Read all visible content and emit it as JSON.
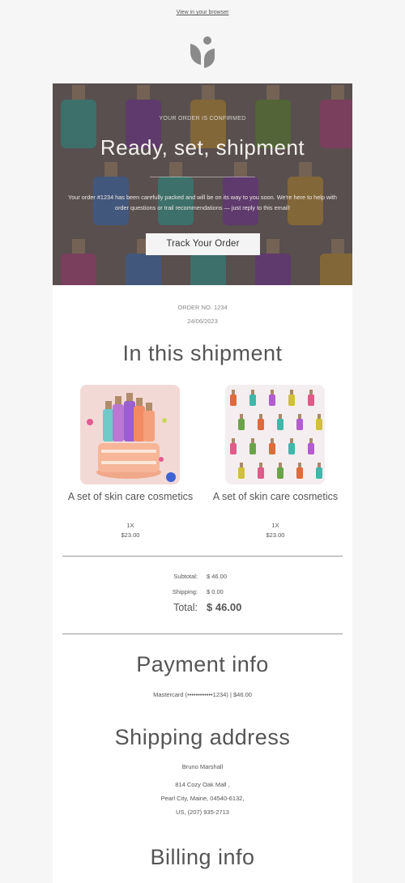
{
  "header": {
    "view_in_browser": "View in your browser",
    "logo_icon": "leaf-logo-icon"
  },
  "hero": {
    "eyebrow": "YOUR ORDER IS CONFIRMED",
    "title": "Ready, set, shipment",
    "body": "Your order #1234 has been carefully packed and will be on its way to you soon. We're here to help with order questions or trail recommendations — just reply to this email!",
    "button_label": "Track Your Order"
  },
  "order": {
    "number": "ORDER NO. 1234",
    "date": "24/06/2023"
  },
  "shipment": {
    "title": "In this shipment",
    "items": [
      {
        "name": "A set of skin care cosmetics",
        "qty": "1X",
        "price": "$23.00"
      },
      {
        "name": "A set of skin care cosmetics",
        "qty": "1X",
        "price": "$23.00"
      }
    ]
  },
  "totals": {
    "subtotal_label": "Subtotal:",
    "subtotal_value": "$ 46.00",
    "shipping_label": "Shipping:",
    "shipping_value": "$ 0.00",
    "total_label": "Total:",
    "total_value": "$ 46.00"
  },
  "payment": {
    "title": "Payment info",
    "line": "Mastercard (••••••••••••1234) | $46.00"
  },
  "shipping_address": {
    "title": "Shipping address",
    "lines": [
      "Bruno Marshall",
      "814 Cozy Oak Mall ,",
      "Pearl City, Maine, 04540-6132,",
      "US, (207) 935-2713"
    ]
  },
  "billing": {
    "title": "Billing info"
  },
  "colors": {
    "page_bg": "#f6f6f6",
    "card_bg": "#ffffff",
    "text": "#555555",
    "button_bg": "#f4f4f4"
  }
}
